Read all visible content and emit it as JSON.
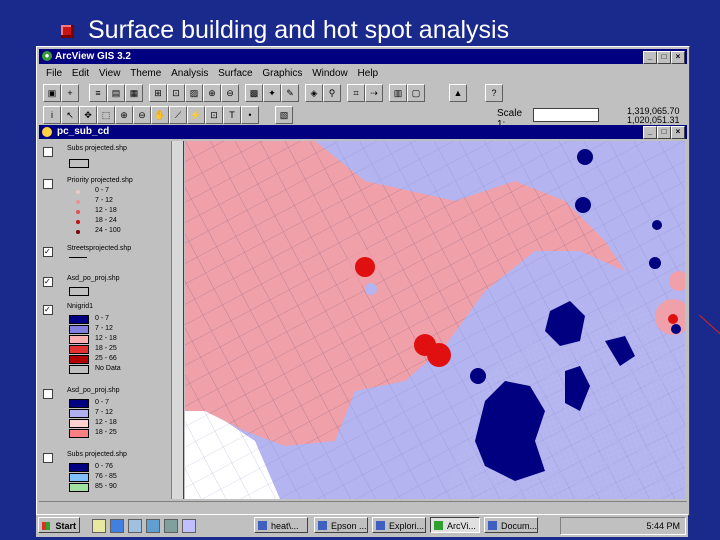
{
  "slide": {
    "title": "Surface building and hot spot analysis"
  },
  "window": {
    "title": "ArcView GIS 3.2",
    "buttons": [
      "_",
      "□",
      "×"
    ]
  },
  "menu": [
    "File",
    "Edit",
    "View",
    "Theme",
    "Analysis",
    "Surface",
    "Graphics",
    "Window",
    "Help"
  ],
  "scale": {
    "label": "Scale 1:",
    "value": "",
    "coord_x": "1,319,065.70",
    "coord_y": "1,020,051.31"
  },
  "view": {
    "title": "pc_sub_cd"
  },
  "toc": [
    {
      "name": "Subs projected.shp",
      "checked": false
    },
    {
      "name": "Priority projected.shp",
      "checked": false,
      "classes": [
        "0 - 7",
        "7 - 12",
        "12 - 18",
        "18 - 24",
        "24 - 100"
      ],
      "colors": [
        "#f0c8c8",
        "#f09090",
        "#e05050",
        "#c01010",
        "#800000"
      ]
    },
    {
      "name": "Streetsprojected.shp",
      "checked": true
    },
    {
      "name": "Asd_po_proj.shp",
      "checked": true
    },
    {
      "name": "Nnigrid1",
      "checked": true,
      "classes": [
        "0 - 7",
        "7 - 12",
        "12 - 18",
        "18 - 25",
        "25 - 66",
        "No Data"
      ],
      "colors": [
        "#000080",
        "#8080e0",
        "#ffb0b0",
        "#e03030",
        "#b00000",
        "#c0c0c0"
      ]
    },
    {
      "name": "Asd_po_proj.shp",
      "checked": false,
      "classes": [
        "0 - 7",
        "7 - 12",
        "12 - 18",
        "18 - 25"
      ],
      "colors": [
        "#000080",
        "#b0b0f0",
        "#ffd0d0",
        "#ff8080"
      ]
    },
    {
      "name": "Subs projected.shp",
      "checked": false,
      "classes": [
        "0 - 76",
        "76 - 85",
        "85 - 90"
      ],
      "colors": [
        "#000080",
        "#80c0ff",
        "#a0e0a0"
      ]
    }
  ],
  "taskbar": {
    "start": "Start",
    "tasks": [
      "heat\\...",
      "Epson ...",
      "Explori...",
      "ArcVi...",
      "Docum..."
    ],
    "clock": "5:44 PM"
  },
  "colors": {
    "slide_bg": "#1a2a8c",
    "title_bar": "#000080",
    "map_bg": "#b4b4f0",
    "hot_zone": "#f0a0a8",
    "cold_zone": "#000080",
    "hot_spot": "#e01010"
  }
}
